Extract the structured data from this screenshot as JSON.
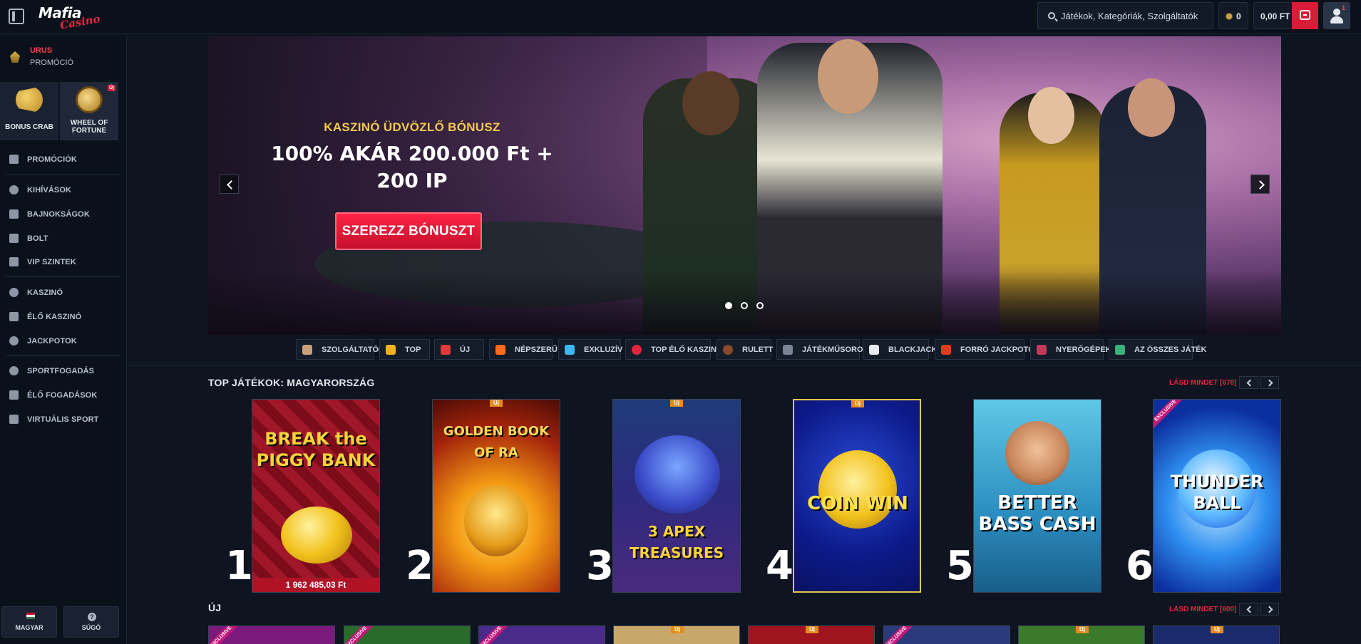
{
  "header": {
    "logo_line1": "Mafia",
    "logo_line2": "Casino",
    "search_placeholder": "Játékok, Kategóriák, Szolgáltatók",
    "coins": "0",
    "balance": "0,00 FT",
    "notification_count": "1"
  },
  "sidebar": {
    "promo_top": {
      "title": "URUS",
      "subtitle": "PROMÓCIÓ"
    },
    "tiles": [
      {
        "label": "BONUS CRAB"
      },
      {
        "label": "WHEEL OF FORTUNE",
        "badge": "Új"
      }
    ],
    "group1": [
      {
        "label": "PROMÓCIÓK"
      }
    ],
    "group2": [
      {
        "label": "KIHÍVÁSOK"
      },
      {
        "label": "BAJNOKSÁGOK"
      },
      {
        "label": "BOLT"
      },
      {
        "label": "VIP SZINTEK"
      }
    ],
    "group3": [
      {
        "label": "KASZINÓ"
      },
      {
        "label": "ÉLŐ KASZINÓ"
      },
      {
        "label": "JACKPOTOK"
      }
    ],
    "group4": [
      {
        "label": "SPORTFOGADÁS"
      },
      {
        "label": "ÉLŐ FOGADÁSOK"
      },
      {
        "label": "VIRTUÁLIS SPORT"
      }
    ],
    "language": "MAGYAR",
    "help": "SÚGÓ"
  },
  "hero": {
    "subtitle": "KASZINÓ ÜDVÖZLŐ BÓNUSZ",
    "title_line1": "100% AKÁR 200.000 Ft +",
    "title_line2": "200 IP",
    "cta": "SZEREZZ BÓNUSZT",
    "slides": 3,
    "active_slide": 1
  },
  "categories": [
    {
      "label": "SZOLGÁLTATÓK",
      "color": "#c9a27a"
    },
    {
      "label": "TOP",
      "color": "#f2b21c"
    },
    {
      "label": "ÚJ",
      "color": "#e23a3a"
    },
    {
      "label": "NÉPSZERŰ",
      "color": "#ff6a1c"
    },
    {
      "label": "EXKLUZÍV",
      "color": "#3fb6f2"
    },
    {
      "label": "TOP ÉLŐ KASZINÓ",
      "color": "#e0263d"
    },
    {
      "label": "RULETT",
      "color": "#8a4a2a"
    },
    {
      "label": "JÁTÉKMŰSOROK",
      "color": "#7a8494"
    },
    {
      "label": "BLACKJACK",
      "color": "#e6e9ee"
    },
    {
      "label": "FORRÓ JACKPOTOK",
      "color": "#e23a1c"
    },
    {
      "label": "NYERŐGÉPEK",
      "color": "#c23a5a"
    },
    {
      "label": "AZ ÖSSZES JÁTÉK",
      "color": "#3ab07a"
    }
  ],
  "top_games": {
    "title": "TOP JÁTÉKOK: MAGYARORSZÁG",
    "see_all": "LÁSD MINDET [678]",
    "games": [
      {
        "rank": "1",
        "name": "BREAK the PIGGY BANK",
        "jackpot": "1 962 485,03 Ft"
      },
      {
        "rank": "2",
        "name": "GOLDEN BOOK OF RA",
        "badge": "Új"
      },
      {
        "rank": "3",
        "name": "3 APEX TREASURES",
        "badge": "Új"
      },
      {
        "rank": "4",
        "name": "COIN WIN",
        "badge": "Új"
      },
      {
        "rank": "5",
        "name": "BETTER BASS CASH"
      },
      {
        "rank": "6",
        "name": "THUNDER BALL",
        "exclusive": "EXCLUSIVE"
      }
    ]
  },
  "new_games": {
    "title": "ÚJ",
    "see_all": "LÁSD MINDET [600]",
    "cards": [
      {
        "exclusive": "EXCLUSIVE"
      },
      {
        "exclusive": "EXCLUSIVE"
      },
      {
        "exclusive": "EXCLUSIVE"
      },
      {
        "badge": "Új"
      },
      {
        "badge": "Új"
      },
      {
        "exclusive": "EXCLUSIVE"
      },
      {
        "badge": "Új"
      },
      {
        "badge": "Új"
      }
    ]
  }
}
